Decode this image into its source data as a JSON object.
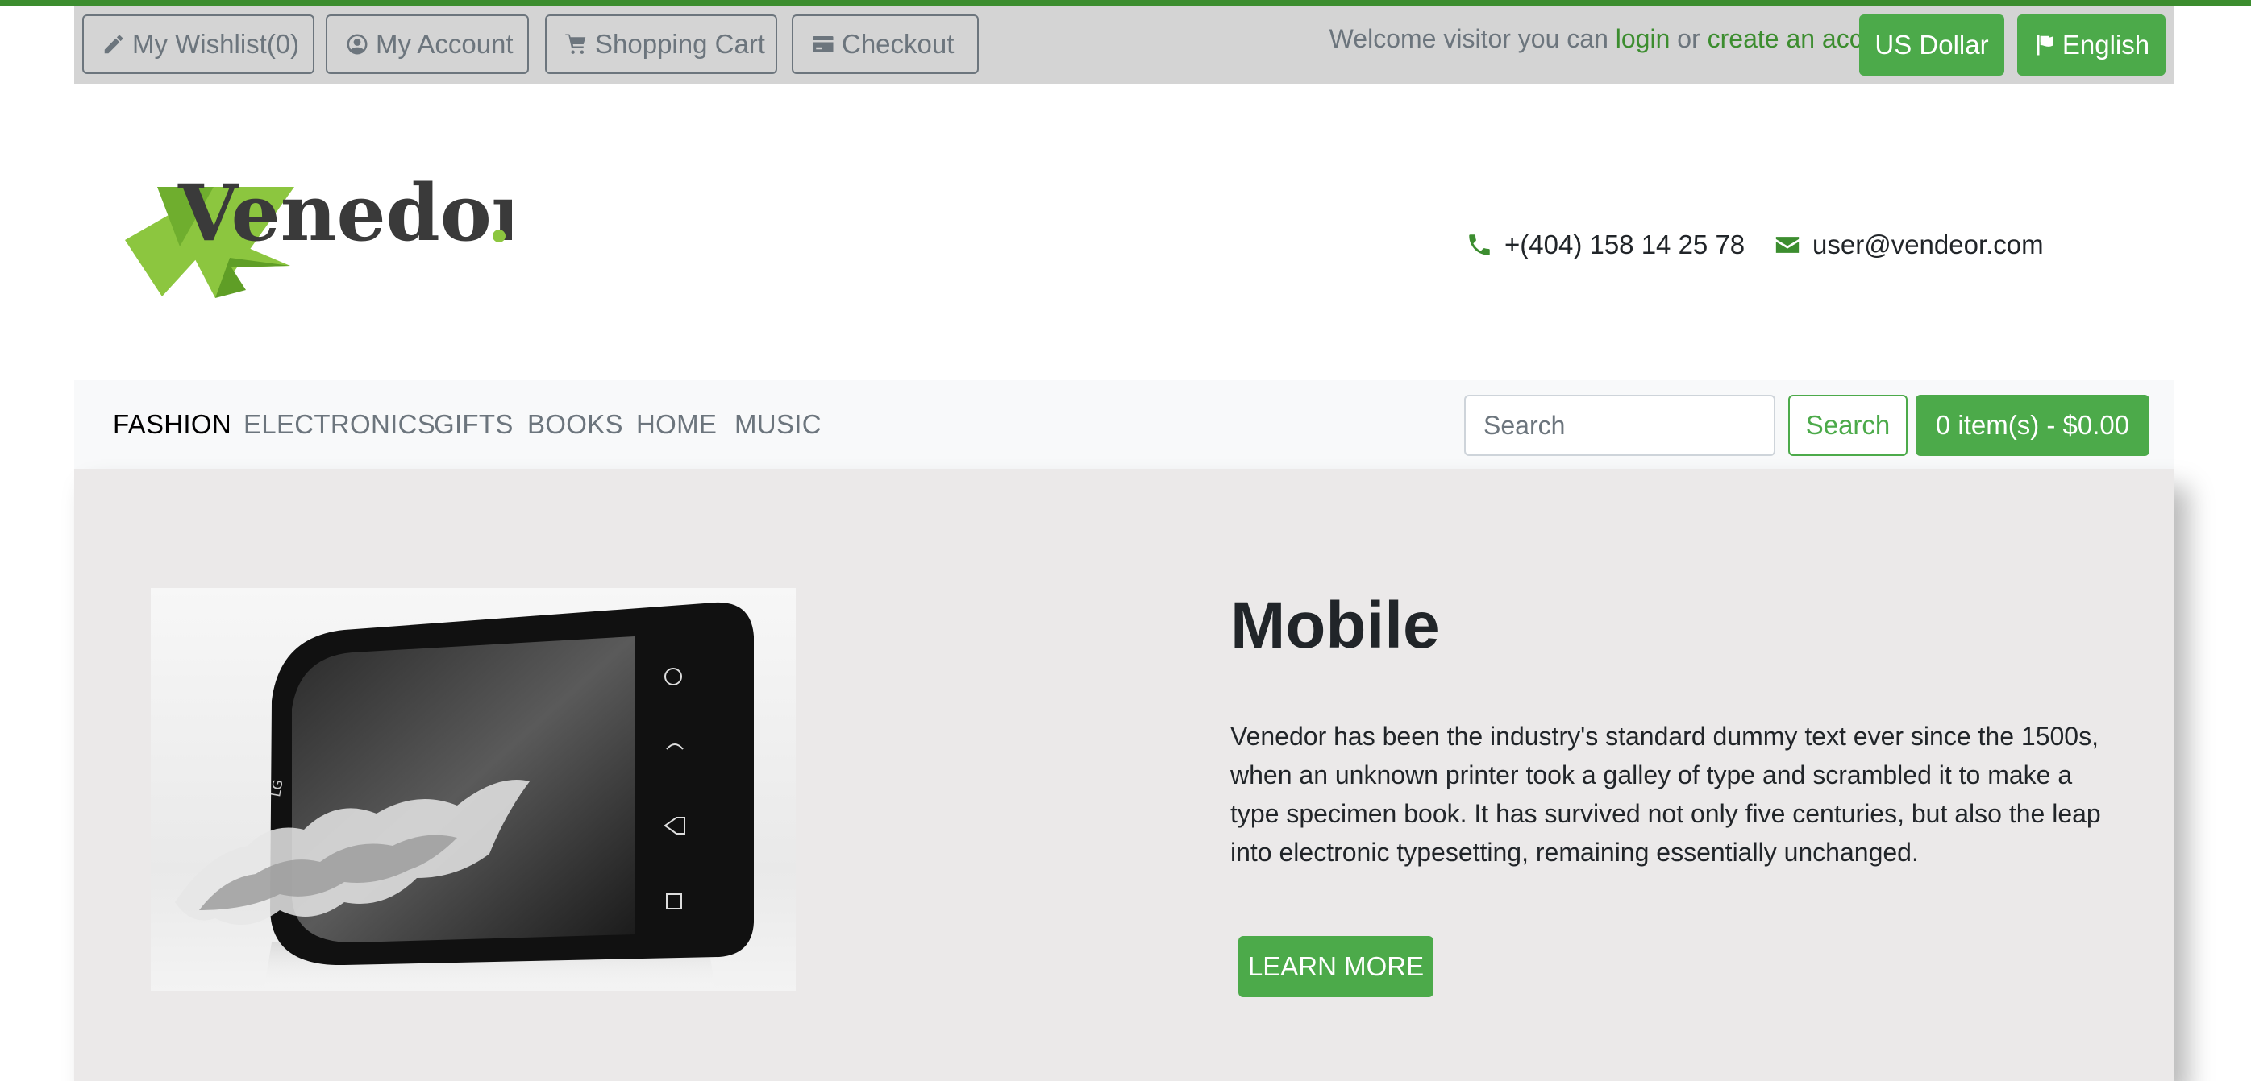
{
  "topbar": {
    "wishlist_label": "My Wishlist(0)",
    "account_label": "My Account",
    "cart_label": "Shopping Cart",
    "checkout_label": "Checkout",
    "welcome_prefix": "Welcome visitor you can",
    "login_label": "login",
    "or_text": "or",
    "create_account_label": "create an account",
    "currency_label": "US Dollar",
    "language_label": "English"
  },
  "header": {
    "logo_text": "Venedor",
    "phone": "+(404) 158 14 25 78",
    "email": "user@vendeor.com"
  },
  "nav": {
    "items": [
      {
        "label": "FASHION",
        "active": true
      },
      {
        "label": "ELECTRONICS",
        "active": false
      },
      {
        "label": "GIFTS",
        "active": false
      },
      {
        "label": "BOOKS",
        "active": false
      },
      {
        "label": "HOME",
        "active": false
      },
      {
        "label": "MUSIC",
        "active": false
      }
    ],
    "search_placeholder": "Search",
    "search_button": "Search",
    "cart_summary": "0 item(s) - $0.00"
  },
  "hero": {
    "title": "Mobile",
    "text": "Venedor has been the industry's standard dummy text ever since the 1500s, when an unknown printer took a galley of type and scrambled it to make a type specimen book. It has survived not only five centuries, but also the leap into electronic typesetting, remaining essentially unchanged.",
    "button_label": "LEARN MORE",
    "phone_brand": "LG"
  },
  "colors": {
    "brand_green": "#4caa4a",
    "link_green": "#3c8d2f",
    "topbar_bg": "#d4d4d4",
    "hero_bg": "#ebe9e9"
  }
}
